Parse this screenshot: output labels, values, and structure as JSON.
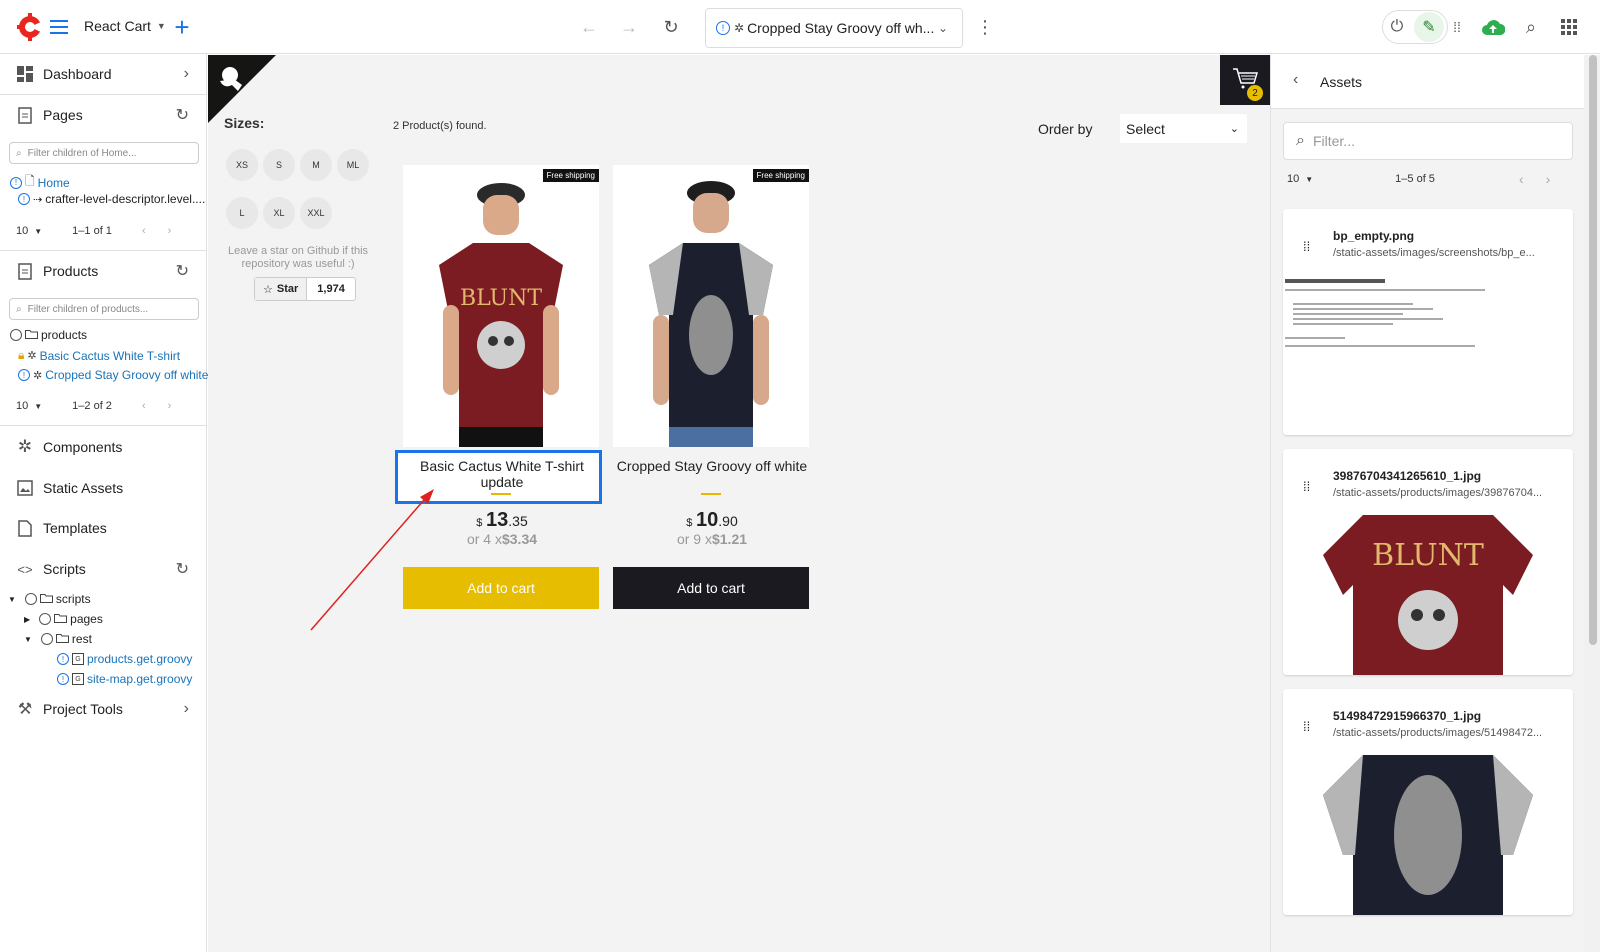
{
  "topbar": {
    "site_name": "React Cart",
    "address": "Cropped Stay Groovy off wh..."
  },
  "sidebar": {
    "dashboard": "Dashboard",
    "pages": "Pages",
    "pages_filter": "Filter children of Home...",
    "home": "Home",
    "crafter": "crafter-level-descriptor.level....",
    "pages_pager_size": "10",
    "pages_pager_range": "1–1 of 1",
    "products": "Products",
    "products_filter": "Filter children of products...",
    "products_folder": "products",
    "product_1": "Basic Cactus White T-shirt",
    "product_2": "Cropped Stay Groovy off white",
    "products_pager_size": "10",
    "products_pager_range": "1–2 of 2",
    "components": "Components",
    "static_assets": "Static Assets",
    "templates": "Templates",
    "scripts": "Scripts",
    "scripts_folder": "scripts",
    "pages_folder": "pages",
    "rest_folder": "rest",
    "script_1": "products.get.groovy",
    "script_2": "site-map.get.groovy",
    "project_tools": "Project Tools"
  },
  "main": {
    "sizes_label": "Sizes:",
    "sizes": [
      "XS",
      "S",
      "M",
      "ML",
      "L",
      "XL",
      "XXL"
    ],
    "github_note": "Leave a star on Github if this repository was useful :)",
    "star_label": "Star",
    "star_count": "1,974",
    "found": "2 Product(s) found.",
    "order_by": "Order by",
    "order_select": "Select",
    "cart_count": "2",
    "products": [
      {
        "badge": "Free shipping",
        "title": "Basic Cactus White T-shirt update",
        "currency": "$",
        "price_int": "13",
        "price_dec": ".35",
        "install_prefix": "or 4 x",
        "install": "$3.34",
        "button": "Add to cart"
      },
      {
        "badge": "Free shipping",
        "title": "Cropped Stay Groovy off white",
        "currency": "$",
        "price_int": "10",
        "price_dec": ".90",
        "install_prefix": "or 9 x",
        "install": "$1.21",
        "button": "Add to cart"
      }
    ],
    "colors": {
      "yellow_button": "#e6bd00",
      "dark_button": "#1b1a20",
      "edit_outline": "#1a73e8",
      "arrow": "#e02020"
    }
  },
  "assets": {
    "title": "Assets",
    "filter_placeholder": "Filter...",
    "pager_size": "10",
    "pager_range": "1–5 of 5",
    "items": [
      {
        "name": "bp_empty.png",
        "path": "/static-assets/images/screenshots/bp_e..."
      },
      {
        "name": "39876704341265610_1.jpg",
        "path": "/static-assets/products/images/39876704..."
      },
      {
        "name": "51498472915966370_1.jpg",
        "path": "/static-assets/products/images/51498472..."
      }
    ]
  }
}
